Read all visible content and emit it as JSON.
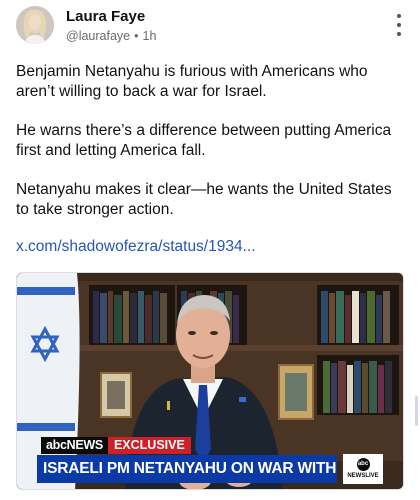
{
  "post": {
    "author_name": "Laura Faye",
    "handle": "@laurafaye",
    "separator": "•",
    "time": "1h",
    "paragraphs": [
      "Benjamin Netanyahu is furious with Americans who aren’t willing to back a war for Israel.",
      "He warns there’s a difference between putting America first and letting America fall.",
      "Netanyahu makes it clear—he wants the United States to take stronger action."
    ],
    "link_text": "x.com/shadowofezra/status/1934..."
  },
  "video": {
    "tag_network": "abcNEWS",
    "tag_label": "EXCLUSIVE",
    "headline": "ISRAELI PM NETANYAHU ON WAR WITH IRAN",
    "bug_logo": "abc",
    "bug_label": "NEWSLIVE"
  },
  "icons": {
    "more": "more-vertical-icon"
  }
}
